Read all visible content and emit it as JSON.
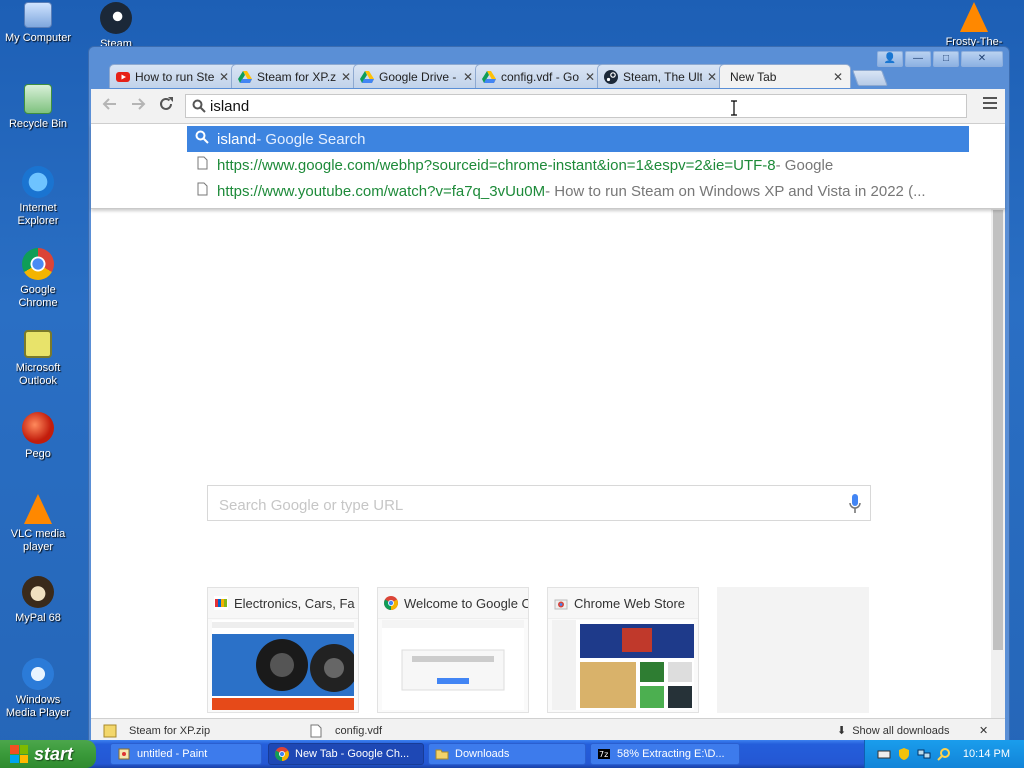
{
  "desktop": {
    "icons": [
      {
        "label": "My Computer",
        "icon": "my-computer-icon"
      },
      {
        "label": "Steam",
        "icon": "steam-icon"
      },
      {
        "label": "Recycle Bin",
        "icon": "recycle-bin-icon"
      },
      {
        "label": "Internet Explorer",
        "icon": "internet-explorer-icon"
      },
      {
        "label": "Google Chrome",
        "icon": "chrome-icon"
      },
      {
        "label": "Microsoft Outlook",
        "icon": "outlook-icon"
      },
      {
        "label": "Pego",
        "icon": "pego-icon"
      },
      {
        "label": "VLC media player",
        "icon": "vlc-icon"
      },
      {
        "label": "MyPal 68",
        "icon": "mypal-icon"
      },
      {
        "label": "Windows Media Player",
        "icon": "media-player-icon"
      },
      {
        "label": "Frosty-The-",
        "icon": "vlc-icon"
      }
    ]
  },
  "browser": {
    "caption_buttons": {
      "user": "👤",
      "minimize": "—",
      "maximize": "□",
      "close": "✕"
    },
    "tabs": [
      {
        "title": "How to run Ste",
        "icon": "youtube-icon",
        "close": "✕"
      },
      {
        "title": "Steam for XP.zi",
        "icon": "google-drive-icon",
        "close": "✕"
      },
      {
        "title": "Google Drive - ",
        "icon": "google-drive-icon",
        "close": "✕"
      },
      {
        "title": "config.vdf - Go",
        "icon": "google-drive-icon",
        "close": "✕"
      },
      {
        "title": "Steam, The Ulti",
        "icon": "steam-icon",
        "close": "✕"
      },
      {
        "title": "New Tab",
        "icon": "",
        "close": "✕",
        "active": true
      }
    ],
    "omnibox": {
      "value": "island"
    },
    "suggestions": [
      {
        "text": "island",
        "desc": " - Google Search",
        "type": "search",
        "selected": true
      },
      {
        "url": "https://www.google.com/webhp?sourceid=chrome-instant&ion=1&espv=2&ie=UTF-8",
        "desc": " - Google",
        "type": "page"
      },
      {
        "url": "https://www.youtube.com/watch?v=fa7q_3vUu0M",
        "desc": " - How to run Steam on Windows XP and Vista in 2022 (...",
        "type": "page"
      }
    ],
    "new_tab": {
      "search_placeholder": "Search Google or type URL",
      "tiles": [
        {
          "title": "Electronics, Cars, Fa",
          "icon": "ebay-icon"
        },
        {
          "title": "Welcome to Google C",
          "icon": "chrome-icon"
        },
        {
          "title": "Chrome Web Store",
          "icon": "chrome-web-store-icon"
        }
      ]
    },
    "downloads": {
      "items": [
        "Steam for XP.zip",
        "config.vdf"
      ],
      "show_all": "Show all downloads"
    }
  },
  "taskbar": {
    "start_label": "start",
    "tasks": [
      {
        "label": "untitled - Paint",
        "icon": "paint-icon"
      },
      {
        "label": "New Tab - Google Ch...",
        "icon": "chrome-icon",
        "active": true
      },
      {
        "label": "Downloads",
        "icon": "folder-icon"
      },
      {
        "label": "58% Extracting E:\\D...",
        "icon": "7zip-icon"
      }
    ],
    "clock": "10:14 PM"
  }
}
